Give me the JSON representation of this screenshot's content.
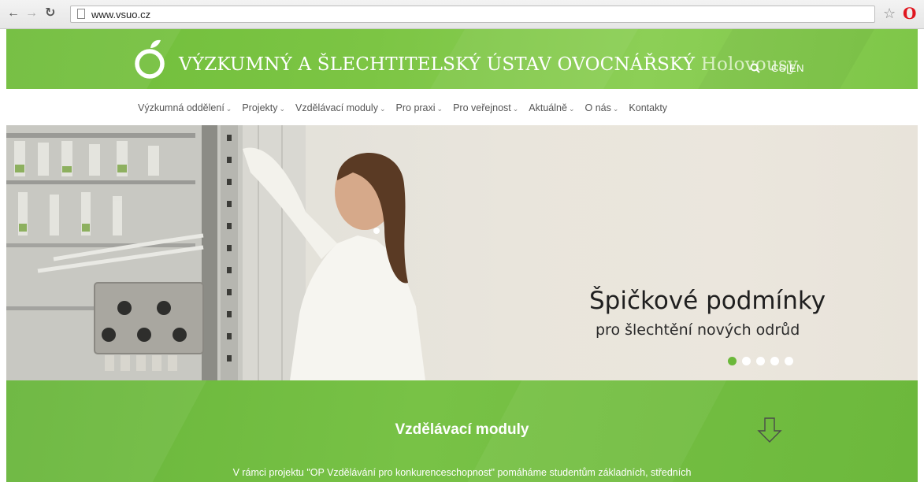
{
  "browser": {
    "url": "www.vsuo.cz",
    "back_icon": "arrow-left-icon",
    "forward_icon": "arrow-right-icon",
    "reload_icon": "reload-icon",
    "bookmark_icon": "star-icon",
    "extension_icon": "opera-icon"
  },
  "header": {
    "title": "VÝZKUMNÝ A ŠLECHTITELSKÝ ÚSTAV OVOCNÁŘSKÝ",
    "title_suffix": "Holovousy",
    "lang": "CS|EN",
    "colors": {
      "green": "#7cc544",
      "accent": "#6bb83a"
    }
  },
  "menu": {
    "items": [
      {
        "label": "Výzkumná oddělení",
        "dropdown": true
      },
      {
        "label": "Projekty",
        "dropdown": true
      },
      {
        "label": "Vzdělávací moduly",
        "dropdown": true
      },
      {
        "label": "Pro praxi",
        "dropdown": true
      },
      {
        "label": "Pro veřejnost",
        "dropdown": true
      },
      {
        "label": "Aktuálně",
        "dropdown": true
      },
      {
        "label": "O nás",
        "dropdown": true
      },
      {
        "label": "Kontakty",
        "dropdown": false
      }
    ]
  },
  "hero": {
    "title": "Špičkové podmínky",
    "subtitle": "pro šlechtění nových odrůd",
    "slides_total": 5,
    "active_slide": 1
  },
  "edu": {
    "title": "Vzdělávací moduly",
    "text": "V rámci projektu \"OP Vzdělávání pro konkurenceschopnost\" pomáháme studentům základních, středních"
  }
}
